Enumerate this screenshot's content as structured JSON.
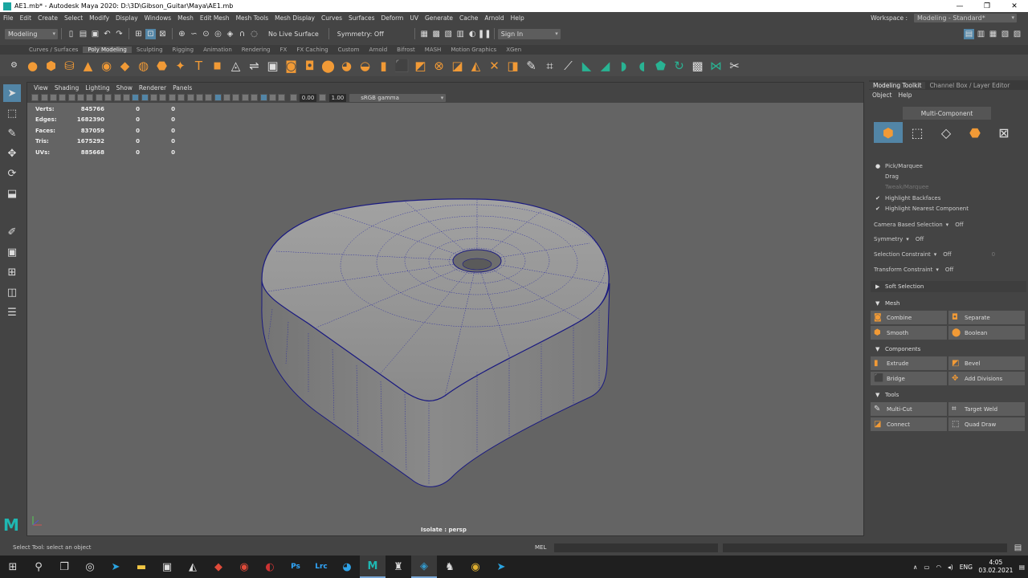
{
  "window": {
    "title": "AE1.mb* - Autodesk Maya 2020: D:\\3D\\Gibson_Guitar\\Maya\\AE1.mb",
    "controls": [
      "—",
      "❐",
      "✕"
    ]
  },
  "menubar": {
    "items": [
      "File",
      "Edit",
      "Create",
      "Select",
      "Modify",
      "Display",
      "Windows",
      "Mesh",
      "Edit Mesh",
      "Mesh Tools",
      "Mesh Display",
      "Curves",
      "Surfaces",
      "Deform",
      "UV",
      "Generate",
      "Cache",
      "Arnold",
      "Help"
    ],
    "workspace_label": "Workspace :",
    "workspace_value": "Modeling - Standard*"
  },
  "statusline": {
    "menuset": "Modeling",
    "live_surface": "No Live Surface",
    "symmetry": "Symmetry: Off",
    "sign_in": "Sign In"
  },
  "shelf": {
    "tabs": [
      "Curves / Surfaces",
      "Poly Modeling",
      "Sculpting",
      "Rigging",
      "Animation",
      "Rendering",
      "FX",
      "FX Caching",
      "Custom",
      "Arnold",
      "Bifrost",
      "MASH",
      "Motion Graphics",
      "XGen"
    ],
    "active_tab": "Poly Modeling"
  },
  "viewport": {
    "menu": [
      "View",
      "Shading",
      "Lighting",
      "Show",
      "Renderer",
      "Panels"
    ],
    "exposure": "0.00",
    "gamma": "1.00",
    "color_space": "sRGB gamma",
    "camera_label": "Isolate : persp",
    "hud": [
      {
        "label": "Verts:",
        "v1": "845766",
        "v2": "0",
        "v3": "0"
      },
      {
        "label": "Edges:",
        "v1": "1682390",
        "v2": "0",
        "v3": "0"
      },
      {
        "label": "Faces:",
        "v1": "837059",
        "v2": "0",
        "v3": "0"
      },
      {
        "label": "Tris:",
        "v1": "1675292",
        "v2": "0",
        "v3": "0"
      },
      {
        "label": "UVs:",
        "v1": "885668",
        "v2": "0",
        "v3": "0"
      }
    ]
  },
  "right_panel": {
    "tabs": [
      "Modeling Toolkit",
      "Channel Box / Layer Editor"
    ],
    "menu": [
      "Object",
      "Help"
    ],
    "multi_component": "Multi-Component",
    "pick_marquee": "Pick/Marquee",
    "drag": "Drag",
    "tweak_marquee": "Tweak/Marquee",
    "highlight_backfaces": "Highlight Backfaces",
    "highlight_nearest": "Highlight Nearest Component",
    "camera_based_selection": "Camera Based Selection",
    "camera_based_selection_value": "Off",
    "symmetry": "Symmetry",
    "symmetry_value": "Off",
    "selection_constraint": "Selection Constraint",
    "selection_constraint_value": "Off",
    "selection_constraint_num": "0",
    "transform_constraint": "Transform Constraint",
    "transform_constraint_value": "Off",
    "soft_selection": "Soft Selection",
    "mesh_section": "Mesh",
    "combine": "Combine",
    "separate": "Separate",
    "smooth": "Smooth",
    "boolean": "Boolean",
    "components_section": "Components",
    "extrude": "Extrude",
    "bevel": "Bevel",
    "bridge": "Bridge",
    "add_divisions": "Add Divisions",
    "tools_section": "Tools",
    "multi_cut": "Multi-Cut",
    "target_weld": "Target Weld",
    "connect": "Connect",
    "quad_draw": "Quad Draw"
  },
  "helpline": {
    "text": "Select Tool: select an object",
    "mel": "MEL"
  },
  "taskbar": {
    "lang": "ENG",
    "time": "4:05",
    "date": "03.02.2021"
  }
}
